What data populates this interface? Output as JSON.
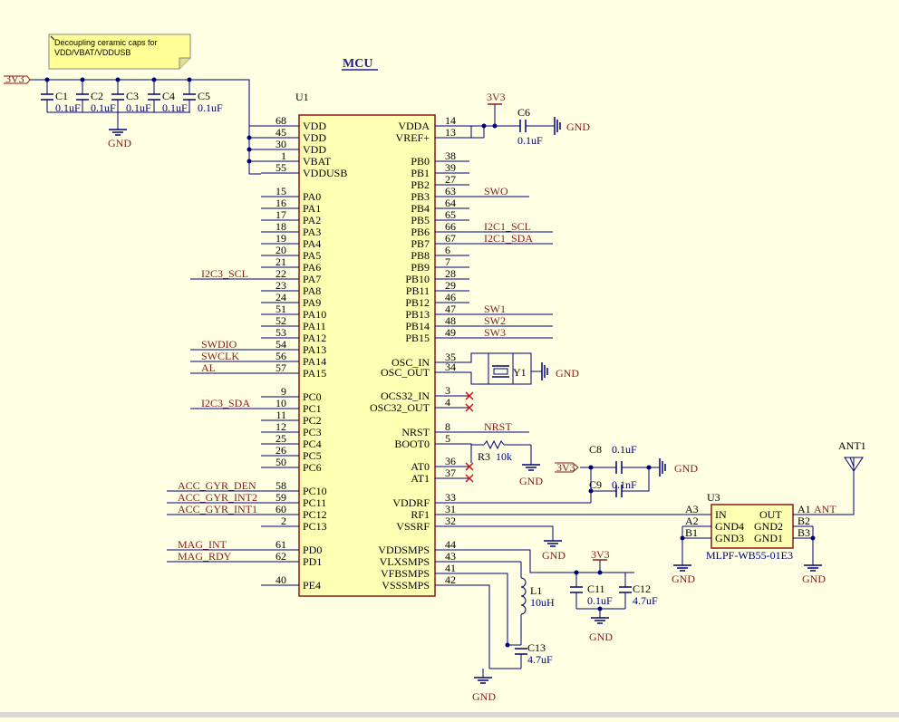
{
  "title": "MCU",
  "note": [
    "Decoupling ceramic caps for",
    "VDD/VBAT/VDDUSB"
  ],
  "u1": {
    "ref": "U1",
    "left_pins": [
      {
        "num": "68",
        "name": "VDD"
      },
      {
        "num": "45",
        "name": "VDD"
      },
      {
        "num": "30",
        "name": "VDD"
      },
      {
        "num": "1",
        "name": "VBAT"
      },
      {
        "num": "55",
        "name": "VDDUSB"
      },
      {
        "num": "15",
        "name": "PA0"
      },
      {
        "num": "16",
        "name": "PA1"
      },
      {
        "num": "17",
        "name": "PA2"
      },
      {
        "num": "18",
        "name": "PA3"
      },
      {
        "num": "19",
        "name": "PA4"
      },
      {
        "num": "20",
        "name": "PA5"
      },
      {
        "num": "21",
        "name": "PA6"
      },
      {
        "num": "22",
        "name": "PA7"
      },
      {
        "num": "23",
        "name": "PA8"
      },
      {
        "num": "24",
        "name": "PA9"
      },
      {
        "num": "51",
        "name": "PA10"
      },
      {
        "num": "52",
        "name": "PA11"
      },
      {
        "num": "53",
        "name": "PA12"
      },
      {
        "num": "54",
        "name": "PA13"
      },
      {
        "num": "56",
        "name": "PA14"
      },
      {
        "num": "57",
        "name": "PA15"
      },
      {
        "num": "9",
        "name": "PC0"
      },
      {
        "num": "10",
        "name": "PC1"
      },
      {
        "num": "11",
        "name": "PC2"
      },
      {
        "num": "12",
        "name": "PC3"
      },
      {
        "num": "25",
        "name": "PC4"
      },
      {
        "num": "26",
        "name": "PC5"
      },
      {
        "num": "50",
        "name": "PC6"
      },
      {
        "num": "58",
        "name": "PC10"
      },
      {
        "num": "59",
        "name": "PC11"
      },
      {
        "num": "60",
        "name": "PC12"
      },
      {
        "num": "2",
        "name": "PC13"
      },
      {
        "num": "61",
        "name": "PD0"
      },
      {
        "num": "62",
        "name": "PD1"
      },
      {
        "num": "40",
        "name": "PE4"
      }
    ],
    "right_pins": [
      {
        "num": "14",
        "name": "VDDA"
      },
      {
        "num": "13",
        "name": "VREF+"
      },
      {
        "num": "38",
        "name": "PB0"
      },
      {
        "num": "39",
        "name": "PB1"
      },
      {
        "num": "27",
        "name": "PB2"
      },
      {
        "num": "63",
        "name": "PB3"
      },
      {
        "num": "64",
        "name": "PB4"
      },
      {
        "num": "65",
        "name": "PB5"
      },
      {
        "num": "66",
        "name": "PB6"
      },
      {
        "num": "67",
        "name": "PB7"
      },
      {
        "num": "6",
        "name": "PB8"
      },
      {
        "num": "7",
        "name": "PB9"
      },
      {
        "num": "28",
        "name": "PB10"
      },
      {
        "num": "29",
        "name": "PB11"
      },
      {
        "num": "46",
        "name": "PB12"
      },
      {
        "num": "47",
        "name": "PB13"
      },
      {
        "num": "48",
        "name": "PB14"
      },
      {
        "num": "49",
        "name": "PB15"
      },
      {
        "num": "35",
        "name": "OSC_IN"
      },
      {
        "num": "34",
        "name": "OSC_OUT"
      },
      {
        "num": "3",
        "name": "OCS32_IN"
      },
      {
        "num": "4",
        "name": "OSC32_OUT"
      },
      {
        "num": "8",
        "name": "NRST"
      },
      {
        "num": "5",
        "name": "BOOT0"
      },
      {
        "num": "36",
        "name": "AT0"
      },
      {
        "num": "37",
        "name": "AT1"
      },
      {
        "num": "33",
        "name": "VDDRF"
      },
      {
        "num": "31",
        "name": "RF1"
      },
      {
        "num": "32",
        "name": "VSSRF"
      },
      {
        "num": "44",
        "name": "VDDSMPS"
      },
      {
        "num": "43",
        "name": "VLXSMPS"
      },
      {
        "num": "41",
        "name": "VFBSMPS"
      },
      {
        "num": "42",
        "name": "VSSSMPS"
      }
    ]
  },
  "left_nets": [
    "I2C3_SCL",
    "SWDIO",
    "SWCLK",
    "AL",
    "I2C3_SDA",
    "ACC_GYR_DEN",
    "ACC_GYR_INT2",
    "ACC_GYR_INT1",
    "MAG_INT",
    "MAG_RDY"
  ],
  "right_nets": [
    "SWO",
    "I2C1_SCL",
    "I2C1_SDA",
    "SW1",
    "SW2",
    "SW3",
    "NRST"
  ],
  "power": {
    "v33": "3V3",
    "gnd": "GND"
  },
  "decoupling_caps": [
    {
      "ref": "C1",
      "value": "0.1uF"
    },
    {
      "ref": "C2",
      "value": "0.1uF"
    },
    {
      "ref": "C3",
      "value": "0.1uF"
    },
    {
      "ref": "C4",
      "value": "0.1uF"
    },
    {
      "ref": "C5",
      "value": "0.1uF"
    }
  ],
  "c6": {
    "ref": "C6",
    "value": "0.1uF"
  },
  "y1": {
    "ref": "Y1"
  },
  "r3": {
    "ref": "R3",
    "value": "10k"
  },
  "c8": {
    "ref": "C8",
    "value": "0.1uF"
  },
  "c9": {
    "ref": "C9",
    "value": "0.1nF"
  },
  "l1": {
    "ref": "L1",
    "value": "10uH"
  },
  "c11": {
    "ref": "C11",
    "value": "0.1uF"
  },
  "c12": {
    "ref": "C12",
    "value": "4.7uF"
  },
  "c13": {
    "ref": "C13",
    "value": "4.7uF"
  },
  "u3": {
    "ref": "U3",
    "part": "MLPF-WB55-01E3",
    "left": [
      {
        "num": "A3",
        "name": "IN"
      },
      {
        "num": "A2",
        "name": "GND4"
      },
      {
        "num": "B1",
        "name": "GND3"
      }
    ],
    "right": [
      {
        "num": "A1",
        "name": "OUT"
      },
      {
        "num": "B2",
        "name": "GND2"
      },
      {
        "num": "B3",
        "name": "GND1"
      }
    ]
  },
  "ant": {
    "ref": "ANT1",
    "net": "ANT"
  }
}
